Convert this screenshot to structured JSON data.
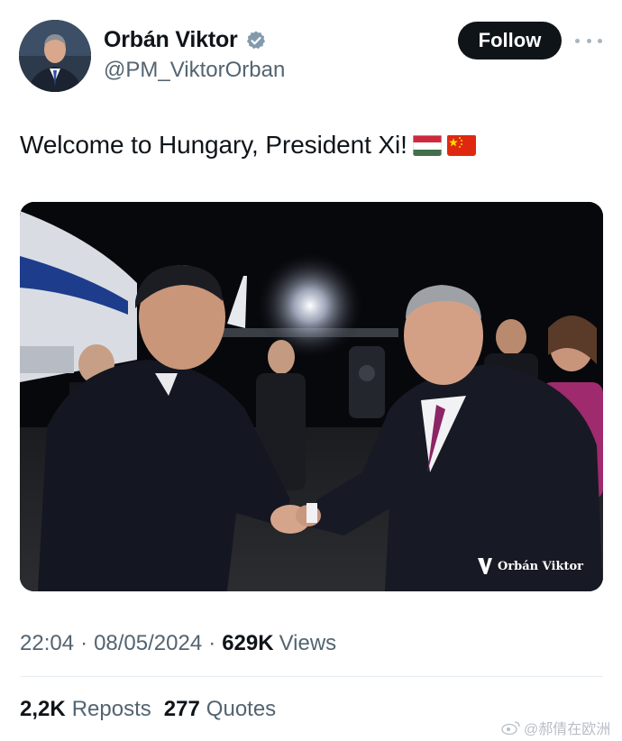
{
  "author": {
    "display_name": "Orbán Viktor",
    "handle": "@PM_ViktorOrban",
    "verified": true
  },
  "follow_label": "Follow",
  "tweet": {
    "text": "Welcome to Hungary, President Xi!",
    "emoji_flags": [
      "hungary-flag-icon",
      "china-flag-icon"
    ]
  },
  "media": {
    "watermark_text": "Orbán Viktor"
  },
  "meta": {
    "time": "22:04",
    "separator": "·",
    "date": "08/05/2024",
    "views_count": "629K",
    "views_label": "Views"
  },
  "stats": {
    "reposts_count": "2,2K",
    "reposts_label": "Reposts",
    "quotes_count": "277",
    "quotes_label": "Quotes"
  },
  "image_watermark": "@郝倩在欧洲",
  "colors": {
    "text_primary": "#0f1419",
    "text_secondary": "#536471",
    "follow_bg": "#0f1419",
    "verified_grey": "#829aab"
  }
}
